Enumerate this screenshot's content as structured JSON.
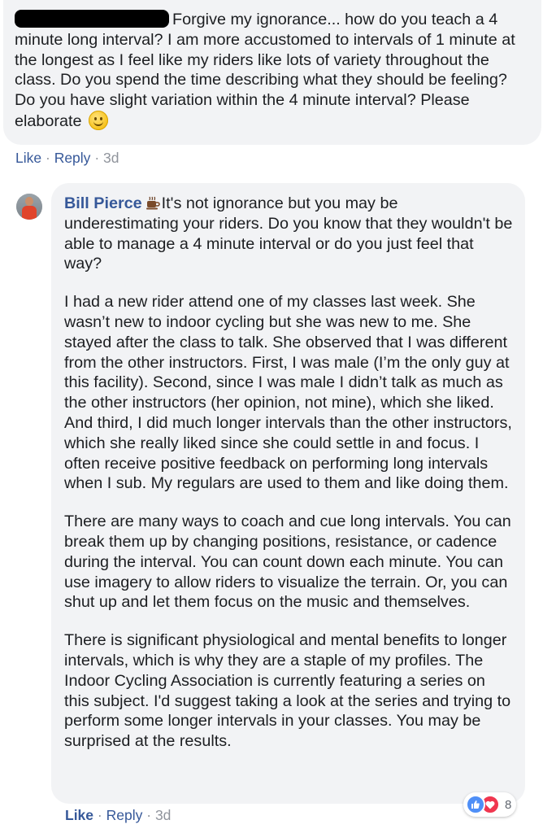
{
  "comment1": {
    "text": "Forgive my ignorance... how do you teach a 4 minute long interval? I am more accustomed to intervals of 1 minute at the longest as I feel like my riders like lots of variety throughout the class. Do you spend the time describing what they should be feeling? Do you have slight variation within the 4 minute interval? Please elaborate",
    "emoji": "smiley-icon",
    "actions": {
      "like": "Like",
      "sep": "·",
      "reply": "Reply",
      "time": "3d"
    }
  },
  "comment2": {
    "author": "Bill Pierce",
    "badge_icon": "coffee-cup-icon",
    "paragraphs": [
      "It's not ignorance but you may be underestimating your riders. Do you know that they wouldn't be able to manage a 4 minute interval or do you just feel that way?",
      "I had a new rider attend one of my classes last week. She wasn’t new to indoor cycling but she was new to me. She stayed after the class to talk. She observed that I was different from the other instructors. First, I was male (I’m the only guy at this facility). Second, since I was male I didn’t talk as much as the other instructors (her opinion, not mine), which she liked. And third, I did much longer intervals than the other instructors, which she really liked since she could settle in and focus. I often receive positive feedback on performing long intervals when I sub. My regulars are used to them and like doing them.",
      "There are many ways to coach and cue long intervals. You can break them up by changing positions, resistance, or cadence during the interval. You can count down each minute. You can use imagery to allow riders to visualize the terrain. Or, you can shut up and let them focus on the music and themselves.",
      "There is significant physiological and mental benefits to longer intervals, which is why they are a staple of my profiles. The Indoor Cycling Association is currently featuring a series on this subject. I'd suggest taking a look at the series and trying to perform some longer intervals in your classes. You may be surprised at the results."
    ],
    "actions": {
      "like": "Like",
      "sep": "·",
      "reply": "Reply",
      "time": "3d"
    },
    "reactions": {
      "icons": [
        "like-reaction-icon",
        "love-reaction-icon"
      ],
      "count": "8"
    }
  },
  "colors": {
    "bubble_bg": "#f2f3f5",
    "link": "#365899",
    "muted": "#90949c",
    "like_blue": "#4f8ff7",
    "love_red": "#f0364f"
  }
}
